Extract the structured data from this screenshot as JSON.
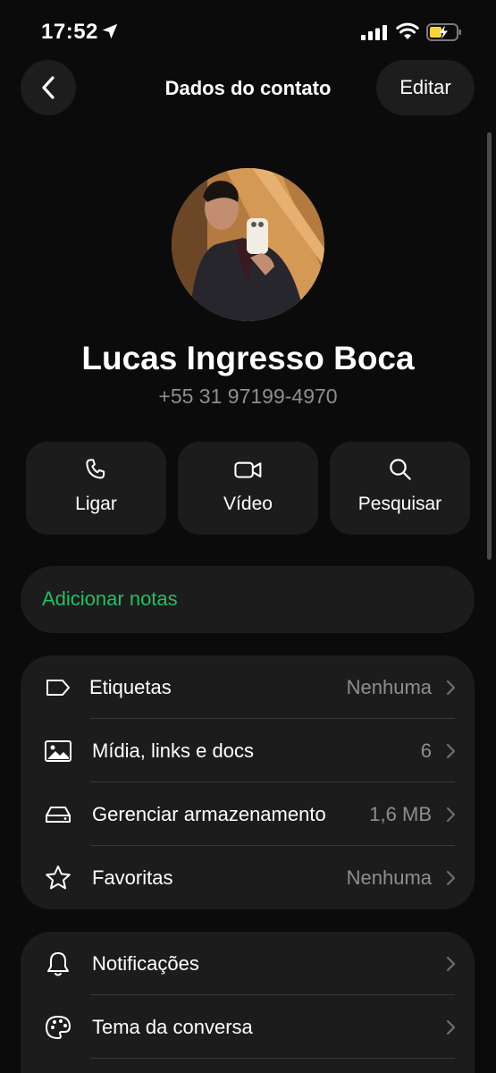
{
  "status_bar": {
    "time": "17:52"
  },
  "header": {
    "title": "Dados do contato",
    "edit_label": "Editar"
  },
  "contact": {
    "name": "Lucas Ingresso Boca",
    "phone": "+55 31 97199-4970"
  },
  "actions": [
    {
      "label": "Ligar",
      "icon": "phone-icon"
    },
    {
      "label": "Vídeo",
      "icon": "video-icon"
    },
    {
      "label": "Pesquisar",
      "icon": "search-icon"
    }
  ],
  "notes": {
    "label": "Adicionar notas"
  },
  "info_list": [
    {
      "label": "Etiquetas",
      "value": "Nenhuma",
      "icon": "label-icon"
    },
    {
      "label": "Mídia, links e docs",
      "value": "6",
      "icon": "image-icon"
    },
    {
      "label": "Gerenciar armazenamento",
      "value": "1,6 MB",
      "icon": "storage-icon"
    },
    {
      "label": "Favoritas",
      "value": "Nenhuma",
      "icon": "star-icon"
    }
  ],
  "settings_list": [
    {
      "label": "Notificações",
      "icon": "bell-icon"
    },
    {
      "label": "Tema da conversa",
      "icon": "palette-icon"
    }
  ],
  "colors": {
    "accent": "#21c063",
    "card": "#1c1c1c",
    "background": "#0b0b0b",
    "secondary_text": "#8e8e8e"
  }
}
